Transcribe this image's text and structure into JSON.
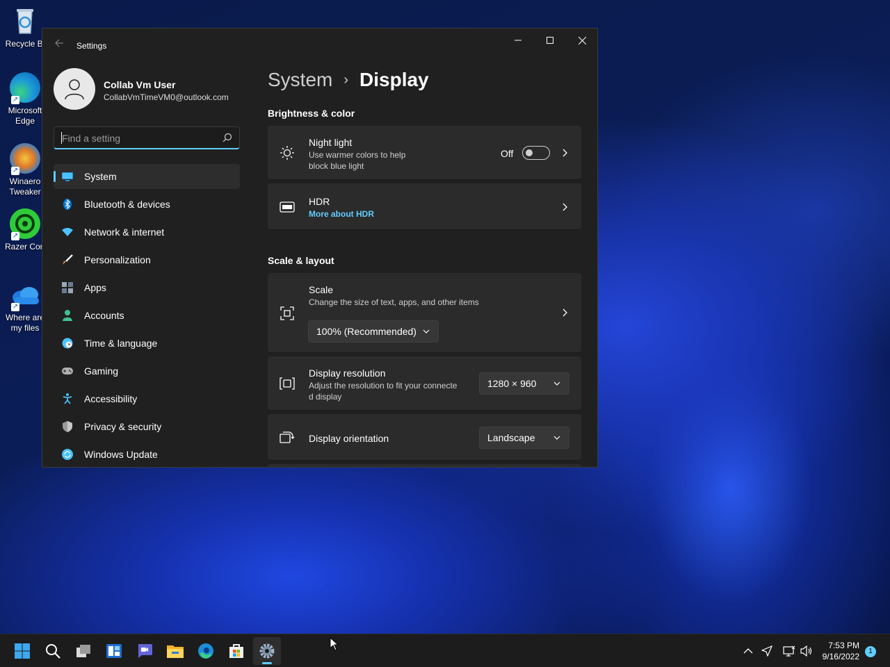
{
  "desktop": {
    "icons": [
      {
        "label_line1": "Recycle Bi",
        "label_line2": ""
      },
      {
        "label_line1": "Microsoft",
        "label_line2": "Edge"
      },
      {
        "label_line1": "Winaero",
        "label_line2": "Tweaker"
      },
      {
        "label_line1": "Razer Cort",
        "label_line2": ""
      },
      {
        "label_line1": "Where are",
        "label_line2": "my files"
      }
    ]
  },
  "window": {
    "title": "Settings",
    "back_icon": "arrow-left-icon",
    "controls": {
      "minimize": "minimize-icon",
      "maximize": "maximize-icon",
      "close": "close-icon"
    }
  },
  "profile": {
    "name": "Collab Vm User",
    "email": "CollabVmTimeVM0@outlook.com"
  },
  "search": {
    "placeholder": "Find a setting"
  },
  "nav": {
    "items": [
      {
        "label": "System",
        "icon": "monitor-icon",
        "color": "#4cc2ff",
        "selected": true
      },
      {
        "label": "Bluetooth & devices",
        "icon": "bluetooth-icon",
        "color": "#0078d4"
      },
      {
        "label": "Network & internet",
        "icon": "wifi-icon",
        "color": "#4cc2ff"
      },
      {
        "label": "Personalization",
        "icon": "brush-icon",
        "color": "#e8a35b"
      },
      {
        "label": "Apps",
        "icon": "apps-icon",
        "color": "#9aa7b8"
      },
      {
        "label": "Accounts",
        "icon": "person-icon",
        "color": "#3ec28f"
      },
      {
        "label": "Time & language",
        "icon": "globe-clock-icon",
        "color": "#4cc2ff"
      },
      {
        "label": "Gaming",
        "icon": "gamepad-icon",
        "color": "#b0b0b0"
      },
      {
        "label": "Accessibility",
        "icon": "accessibility-icon",
        "color": "#4cc2ff"
      },
      {
        "label": "Privacy & security",
        "icon": "shield-icon",
        "color": "#9a9a9a"
      },
      {
        "label": "Windows Update",
        "icon": "update-icon",
        "color": "#4cc2ff"
      }
    ]
  },
  "breadcrumb": {
    "parent": "System",
    "separator": "›",
    "current": "Display"
  },
  "sections": {
    "brightness": {
      "title": "Brightness & color",
      "night_light": {
        "title": "Night light",
        "desc_line1": "Use warmer colors to help",
        "desc_line2": "block blue light",
        "toggle_label": "Off",
        "toggle_on": false
      },
      "hdr": {
        "title": "HDR",
        "link": "More about HDR"
      }
    },
    "scale_layout": {
      "title": "Scale & layout",
      "scale": {
        "title": "Scale",
        "desc": "Change the size of text, apps, and other items",
        "value": "100% (Recommended)"
      },
      "resolution": {
        "title": "Display resolution",
        "desc_line1": "Adjust the resolution to fit your connecte",
        "desc_line2": "d display",
        "value": "1280 × 960"
      },
      "orientation": {
        "title": "Display orientation",
        "value": "Landscape"
      }
    }
  },
  "taskbar": {
    "apps": [
      "start-icon",
      "search-icon",
      "task-view-icon",
      "widgets-icon",
      "chat-icon",
      "file-explorer-icon",
      "edge-icon",
      "store-icon",
      "settings-icon"
    ],
    "active_app": "settings-icon",
    "tray": [
      "chevron-up-icon",
      "location-icon",
      "network-icon",
      "volume-icon"
    ],
    "time": "7:53 PM",
    "date": "9/16/2022",
    "notification_count": "1"
  },
  "colors": {
    "accent": "#60cdff",
    "window_bg": "#202020",
    "card_bg": "#2b2b2b"
  }
}
